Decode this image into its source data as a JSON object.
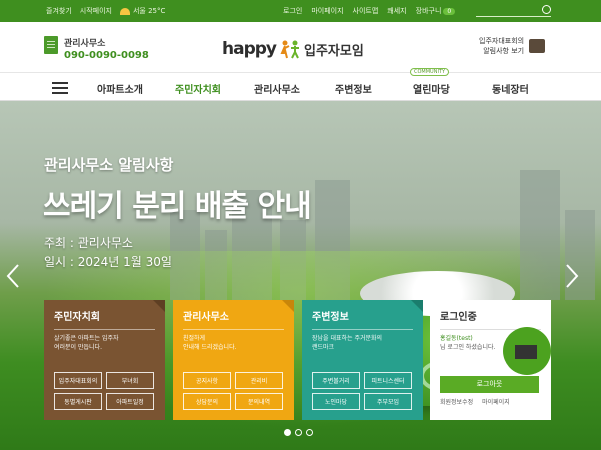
{
  "topbar": {
    "links": [
      "즐겨찾기",
      "시작페이지"
    ],
    "weather": "서울 25°C",
    "util_links": [
      "로그인",
      "마이페이지",
      "사이트맵",
      "쾌세지"
    ],
    "cart": "장바구니",
    "cart_count": "0",
    "search_placeholder": ""
  },
  "header": {
    "office_title": "관리사무소",
    "office_phone": "090-0090-0098",
    "logo_text": "happy",
    "logo_sub": "입주자모임",
    "chairman_line1": "입주자대표회의",
    "chairman_line2": "알림사항 보기"
  },
  "nav": {
    "items": [
      "아파트소개",
      "주민자치회",
      "관리사무소",
      "주변정보",
      "열린마당",
      "동네장터"
    ],
    "active_index": 1,
    "community_badge": "COMMUNITY"
  },
  "hero": {
    "subtitle": "관리사무소 알림사항",
    "title": "쓰레기 분리 배출 안내",
    "host": "주최 : 관리사무소",
    "date": "일시 : 2024년 1월 30일"
  },
  "cards": [
    {
      "title": "주민자치회",
      "desc": "살기좋은 아파트는 입주자\n여러분이 만듭니다.",
      "buttons": [
        "입주자대표회의",
        "부녀회",
        "동별게시판",
        "아파트일정"
      ]
    },
    {
      "title": "관리사무소",
      "desc": "친절하게\n안내해 드리겠습니다.",
      "buttons": [
        "공지사항",
        "관리비",
        "상담문의",
        "문의내역"
      ]
    },
    {
      "title": "주변정보",
      "desc": "장남을 대표하는 주거문화의\n랜드마크",
      "buttons": [
        "주변볼거리",
        "피트니스센터",
        "노인마당",
        "주부모임"
      ]
    }
  ],
  "login": {
    "title": "로그인중",
    "user": "홍길동(test)",
    "message": "님 로그인 하셨습니다.",
    "logout_button": "로그아웃",
    "links": [
      "회원정보수정",
      "마이페이지"
    ]
  },
  "slider": {
    "dot_count": 3,
    "active_dot": 0
  },
  "colors": {
    "brand_green": "#3f8f1f",
    "card_brown": "#7a5432",
    "card_orange": "#f0a712",
    "card_teal": "#27a08d"
  },
  "icons": [
    "sun-icon",
    "search-icon",
    "building-icon",
    "megaphone-icon",
    "menu-icon",
    "chevron-left-icon",
    "chevron-right-icon",
    "mail-icon"
  ]
}
